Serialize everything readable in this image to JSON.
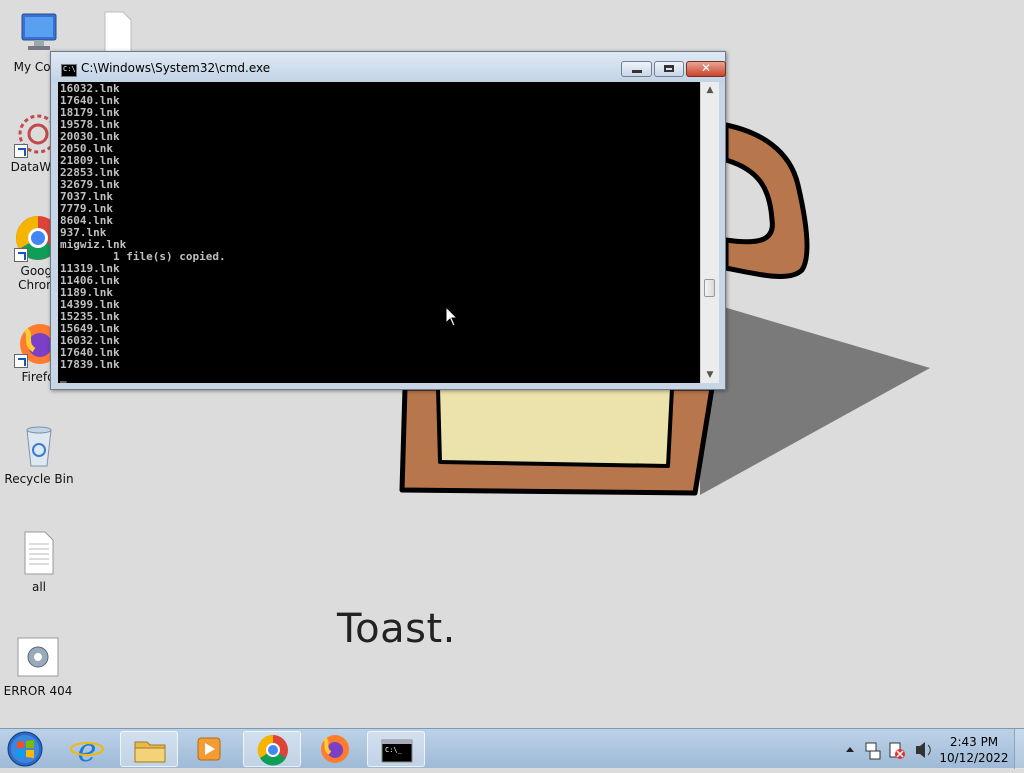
{
  "desktop": {
    "caption": "Toast.",
    "icons": [
      {
        "label": "My Com"
      },
      {
        "label": ""
      },
      {
        "label": "DataWag"
      },
      {
        "label": "Googl\nChrom"
      },
      {
        "label": "Firefo"
      },
      {
        "label": "Recycle Bin"
      },
      {
        "label": "all"
      },
      {
        "label": "ERROR 404"
      }
    ]
  },
  "window": {
    "title": "C:\\Windows\\System32\\cmd.exe",
    "icon": "cmd-icon",
    "close_label": "✕",
    "console_lines": [
      "16032.lnk",
      "17640.lnk",
      "18179.lnk",
      "19578.lnk",
      "20030.lnk",
      "2050.lnk",
      "21809.lnk",
      "22853.lnk",
      "32679.lnk",
      "7037.lnk",
      "7779.lnk",
      "8604.lnk",
      "937.lnk",
      "migwiz.lnk",
      "        1 file(s) copied.",
      "11319.lnk",
      "11406.lnk",
      "1189.lnk",
      "14399.lnk",
      "15235.lnk",
      "15649.lnk",
      "16032.lnk",
      "17640.lnk",
      "17839.lnk",
      "_"
    ],
    "scroll_position": 0.72
  },
  "taskbar": {
    "start_icon": "windows-start-icon",
    "items": [
      {
        "name": "internet-explorer-icon"
      },
      {
        "name": "file-explorer-icon"
      },
      {
        "name": "media-player-icon"
      },
      {
        "name": "chrome-icon"
      },
      {
        "name": "firefox-icon"
      },
      {
        "name": "cmd-icon"
      }
    ],
    "tray_icons": [
      "show-hidden-icons",
      "network-icon",
      "action-center-icon",
      "volume-icon"
    ],
    "time": "2:43 PM",
    "date": "10/12/2022"
  },
  "colors": {
    "desktop": "#dcdcdc",
    "toast_crust": "#b8764c",
    "toast_center": "#ece3ac",
    "shadow": "#7d7d7d"
  }
}
